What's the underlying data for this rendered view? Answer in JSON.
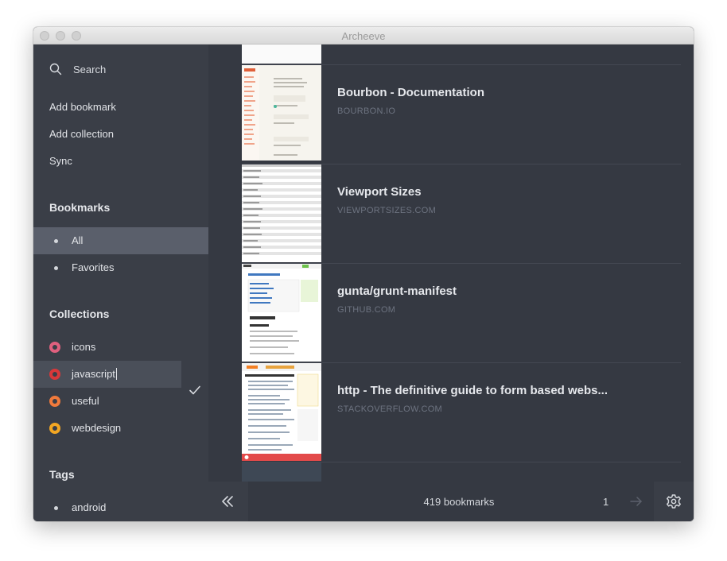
{
  "window": {
    "title": "Archeeve"
  },
  "sidebar": {
    "search_label": "Search",
    "actions": [
      "Add bookmark",
      "Add collection",
      "Sync"
    ],
    "bookmarks_title": "Bookmarks",
    "bookmarks": [
      {
        "label": "All",
        "selected": true
      },
      {
        "label": "Favorites",
        "selected": false
      }
    ],
    "collections_title": "Collections",
    "collections": [
      {
        "label": "icons",
        "color": "#e0607e"
      },
      {
        "label": "javascript",
        "color": "#d8383a",
        "editing": true
      },
      {
        "label": "useful",
        "color": "#f07a3c"
      },
      {
        "label": "webdesign",
        "color": "#f2a623"
      }
    ],
    "tags_title": "Tags",
    "tags": [
      {
        "label": "android"
      }
    ]
  },
  "bookmarks": [
    {
      "title": "Bourbon - Documentation",
      "domain": "BOURBON.IO"
    },
    {
      "title": "Viewport Sizes",
      "domain": "VIEWPORTSIZES.COM"
    },
    {
      "title": "gunta/grunt-manifest",
      "domain": "GITHUB.COM"
    },
    {
      "title": "http - The definitive guide to form based webs...",
      "domain": "STACKOVERFLOW.COM"
    }
  ],
  "footer": {
    "count_label": "419 bookmarks",
    "page": "1"
  },
  "icons": {
    "search": "search-icon",
    "collapse": "double-chevron-left-icon",
    "next": "arrow-right-icon",
    "settings": "gear-icon",
    "check": "check-icon"
  },
  "colors": {
    "background": "#353942",
    "sidebar": "#3a3e47",
    "selected": "#5a5f6b"
  }
}
